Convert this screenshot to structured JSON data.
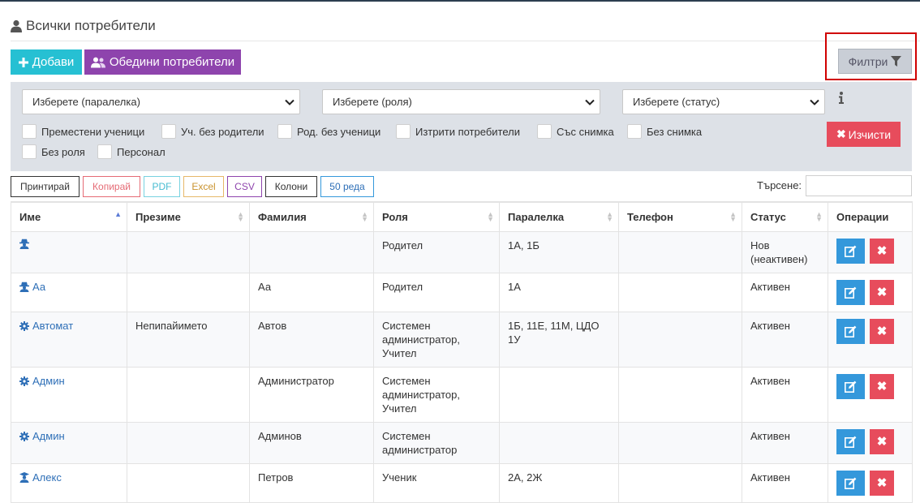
{
  "page": {
    "title": "Всички потребители"
  },
  "toolbar": {
    "add_label": "Добави",
    "merge_label": "Обедини потребители",
    "filters_label": "Филтри"
  },
  "filters": {
    "class_select": "Изберете (паралелка)",
    "role_select": "Изберете (роля)",
    "status_select": "Изберете (статус)",
    "checkboxes": [
      "Преместени ученици",
      "Уч. без родители",
      "Род. без ученици",
      "Изтрити потребители",
      "Със снимка",
      "Без снимка",
      "Без роля",
      "Персонал"
    ],
    "clear_label": "Изчисти"
  },
  "table_tools": {
    "buttons": [
      "Принтирай",
      "Копирай",
      "PDF",
      "Excel",
      "CSV",
      "Колони",
      "50 реда"
    ],
    "search_label": "Търсене:",
    "search_value": ""
  },
  "table": {
    "columns": [
      "Име",
      "Презиме",
      "Фамилия",
      "Роля",
      "Паралелка",
      "Телефон",
      "Статус",
      "Операции"
    ],
    "rows": [
      {
        "icon": "parent-icon",
        "name": "",
        "middle": "",
        "last": "",
        "role": "Родител",
        "class": "1А, 1Б",
        "phone": "",
        "status": "Нов (неактивен)"
      },
      {
        "icon": "parent-icon",
        "name": "Аа",
        "middle": "",
        "last": "Аа",
        "role": "Родител",
        "class": "1А",
        "phone": "",
        "status": "Активен"
      },
      {
        "icon": "gear-icon",
        "name": "Автомат",
        "middle": "Непипайимето",
        "last": "Автов",
        "role": "Системен администратор, Учител",
        "class": "1Б, 11Е, 11М, ЦДО 1У",
        "phone": "",
        "status": "Активен"
      },
      {
        "icon": "gear-icon",
        "name": "Админ",
        "middle": "",
        "last": "Администратор",
        "role": "Системен администратор, Учител",
        "class": "",
        "phone": "",
        "status": "Активен"
      },
      {
        "icon": "gear-icon",
        "name": "Админ",
        "middle": "",
        "last": "Админов",
        "role": "Системен администратор",
        "class": "",
        "phone": "",
        "status": "Активен"
      },
      {
        "icon": "student-icon",
        "name": "Алекс",
        "middle": "",
        "last": "Петров",
        "role": "Ученик",
        "class": "2А, 2Ж",
        "phone": "",
        "status": "Активен"
      }
    ]
  },
  "colors": {
    "add": "#26c0d3",
    "merge": "#8e44ad",
    "clear": "#e74c5c",
    "edit": "#3498db",
    "delete": "#e74c5c",
    "link": "#2e6fb7"
  }
}
